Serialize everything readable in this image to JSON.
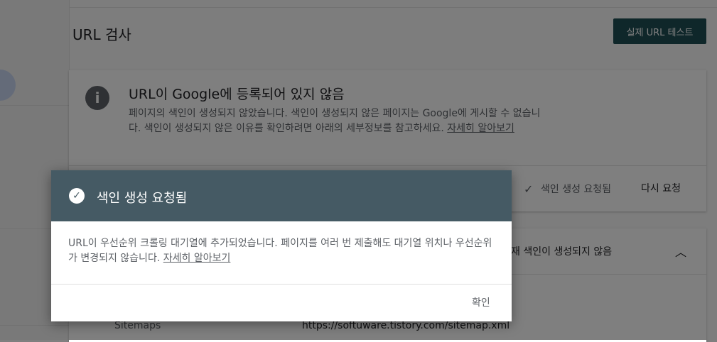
{
  "page": {
    "title": "URL 검사",
    "live_test_button": "실제 URL 테스트"
  },
  "status_card": {
    "icon": "info-icon",
    "title": "URL이 Google에 등록되어 있지 않음",
    "body": "페이지의 색인이 생성되지 않았습니다. 색인이 생성되지 않은 페이지는 Google에 게시할 수 없습니다. 색인이 생성되지 않은 이유를 확인하려면 아래의 세부정보를 참고하세요.",
    "link": "자세히 알아보기",
    "status_text": "색인 생성 요청됨",
    "retry_button": "다시 요청"
  },
  "coverage_card": {
    "title": "페이지 색인이 생성되지 않음",
    "visible_title": "재 색인이 생성되지 않음",
    "sitemaps_label": "Sitemaps",
    "sitemaps_value": "https://softuware.tistory.com/sitemap.xml"
  },
  "dialog": {
    "title": "색인 생성 요청됨",
    "body": "URL이 우선순위 크롤링 대기열에 추가되었습니다. 페이지를 여러 번 제출해도 대기열 위치나 우선순위가 변경되지 않습니다.",
    "link": "자세히 알아보기",
    "ok_button": "확인",
    "header_color": "#455a64"
  }
}
